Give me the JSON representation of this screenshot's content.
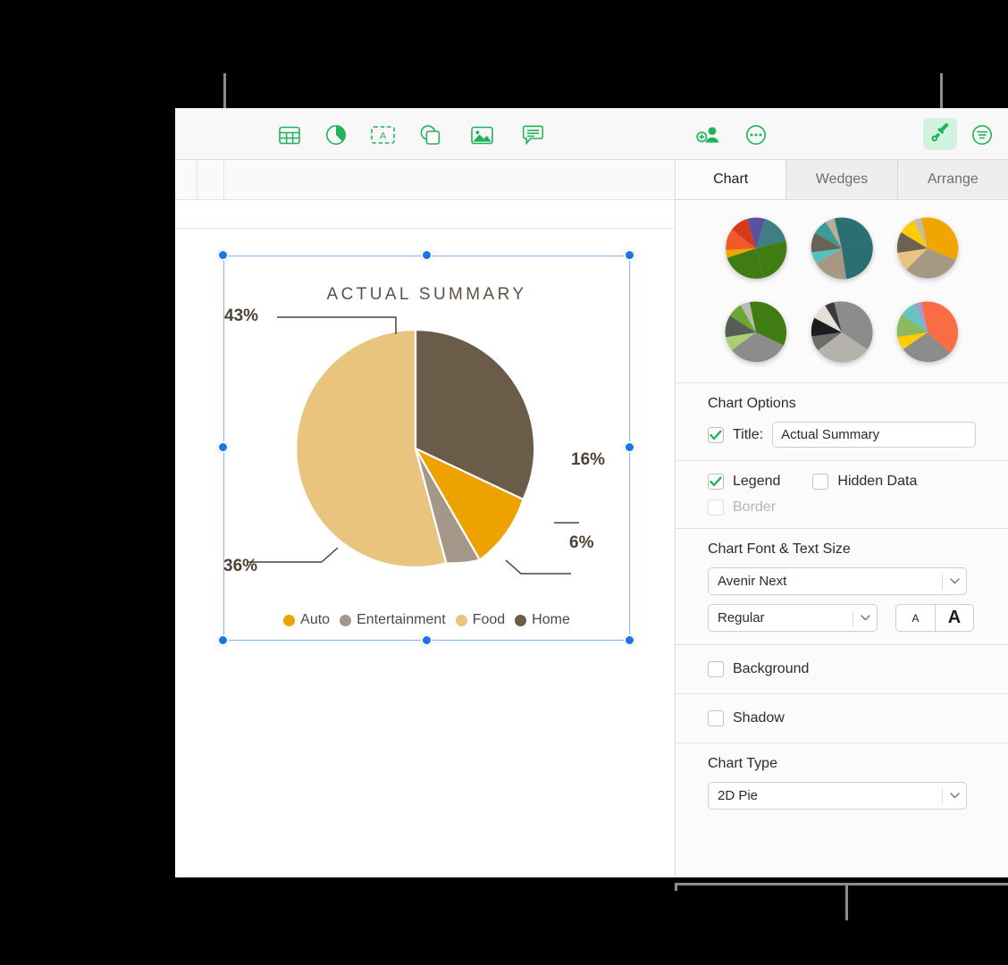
{
  "toolbar": {
    "icons": [
      {
        "name": "table-icon",
        "label": "Table"
      },
      {
        "name": "chart-icon",
        "label": "Chart"
      },
      {
        "name": "text-box-icon",
        "label": "Text"
      },
      {
        "name": "shape-icon",
        "label": "Shape"
      },
      {
        "name": "media-icon",
        "label": "Media"
      },
      {
        "name": "comment-icon",
        "label": "Comment"
      }
    ],
    "collaborate_label": "Collaborate",
    "more_label": "More",
    "format_label": "Format",
    "organize_label": "Organize"
  },
  "sidebar": {
    "tabs": [
      {
        "label": "Chart",
        "active": true
      },
      {
        "label": "Wedges",
        "active": false
      },
      {
        "label": "Arrange",
        "active": false
      }
    ],
    "style_thumbnails": [
      {
        "name": "chart-style-1",
        "selected": false
      },
      {
        "name": "chart-style-2",
        "selected": false
      },
      {
        "name": "chart-style-3",
        "selected": false
      },
      {
        "name": "chart-style-4",
        "selected": false
      },
      {
        "name": "chart-style-5",
        "selected": false
      },
      {
        "name": "chart-style-6",
        "selected": false
      }
    ],
    "chart_options": {
      "heading": "Chart Options",
      "title_checkbox_label": "Title:",
      "title_checked": true,
      "title_value": "Actual Summary",
      "legend_label": "Legend",
      "legend_checked": true,
      "hidden_data_label": "Hidden Data",
      "hidden_data_checked": false,
      "border_label": "Border",
      "border_checked": false,
      "border_disabled": true
    },
    "font_section": {
      "heading": "Chart Font & Text Size",
      "font_family": "Avenir Next",
      "font_style": "Regular",
      "decrease_size_label": "A",
      "increase_size_label": "A"
    },
    "background": {
      "label": "Background",
      "checked": false
    },
    "shadow": {
      "label": "Shadow",
      "checked": false
    },
    "chart_type": {
      "heading": "Chart Type",
      "value": "2D Pie"
    }
  },
  "chart_data": {
    "type": "pie",
    "title": "ACTUAL SUMMARY",
    "categories": [
      "Home",
      "Auto",
      "Entertainment",
      "Food"
    ],
    "values": [
      43,
      16,
      6,
      36
    ],
    "value_labels": [
      "43%",
      "16%",
      "6%",
      "36%"
    ],
    "colors": [
      "#6b5c4a",
      "#eda200",
      "#a4978a",
      "#e9c47f"
    ],
    "legend": [
      {
        "label": "Auto",
        "color": "#eda200"
      },
      {
        "label": "Entertainment",
        "color": "#a4978a"
      },
      {
        "label": "Food",
        "color": "#e9c47f"
      },
      {
        "label": "Home",
        "color": "#6b5c4a"
      }
    ],
    "legend_position": "bottom",
    "grid": false,
    "xlabel": "",
    "ylabel": ""
  },
  "theme": {
    "accent_green": "#21b35c",
    "brush_button_bg": "#d4f2e0",
    "selection_blue": "#1a73e8",
    "selection_frame": "#8ab4f8",
    "callout_gray": "#8c8c8c"
  }
}
